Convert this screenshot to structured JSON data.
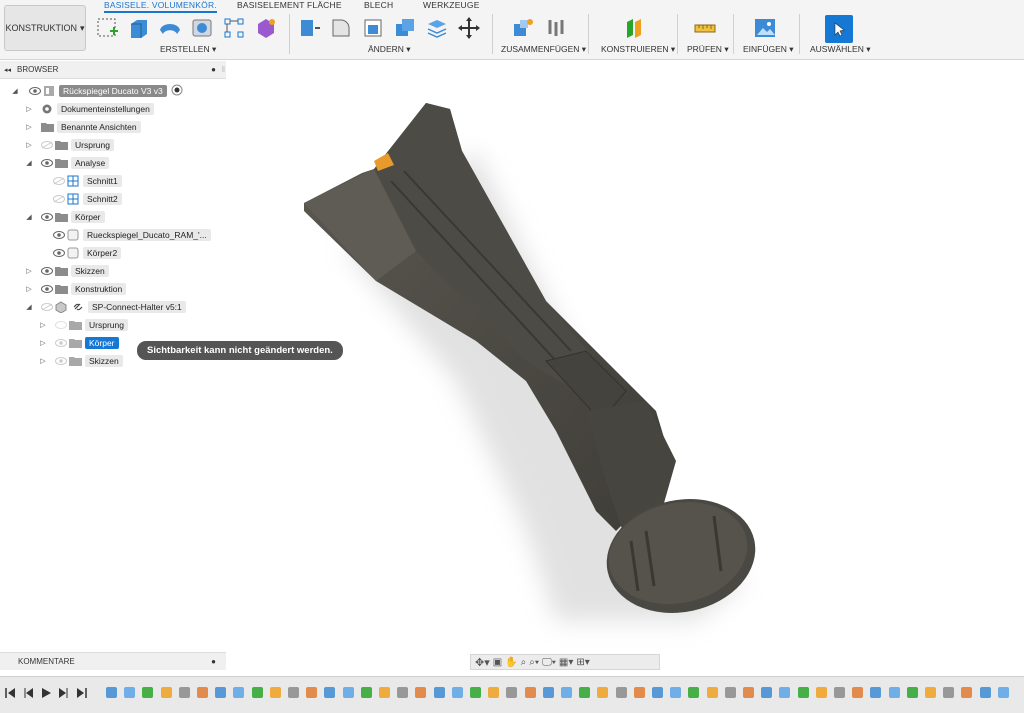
{
  "toolbar": {
    "workspace": "KONSTRUKTION",
    "tabs": [
      "BASISELE. VOLUMENKÖR.",
      "BASISELEMENT FLÄCHE",
      "BLECH",
      "WERKZEUGE"
    ],
    "groups": {
      "create": "ERSTELLEN",
      "modify": "ÄNDERN",
      "assemble": "ZUSAMMENFÜGEN",
      "construct": "KONSTRUIEREN",
      "inspect": "PRÜFEN",
      "insert": "EINFÜGEN",
      "select": "AUSWÄHLEN"
    }
  },
  "browser": {
    "title": "BROWSER",
    "root": "Rückspiegel Ducato V3 v3",
    "items": [
      {
        "label": "Dokumenteinstellungen"
      },
      {
        "label": "Benannte Ansichten"
      },
      {
        "label": "Ursprung"
      },
      {
        "label": "Analyse"
      },
      {
        "label": "Schnitt1"
      },
      {
        "label": "Schnitt2"
      },
      {
        "label": "Körper"
      },
      {
        "label": "Rueckspiegel_Ducato_RAM_'..."
      },
      {
        "label": "Körper2"
      },
      {
        "label": "Skizzen"
      },
      {
        "label": "Konstruktion"
      },
      {
        "label": "SP-Connect-Halter v5:1"
      },
      {
        "label": "Ursprung"
      },
      {
        "label": "Körper"
      },
      {
        "label": "Skizzen"
      }
    ]
  },
  "tooltip": "Sichtbarkeit kann nicht geändert werden.",
  "comments": "KOMMENTARE",
  "colors": {
    "accent": "#1478d4",
    "model": "#4a4842"
  }
}
